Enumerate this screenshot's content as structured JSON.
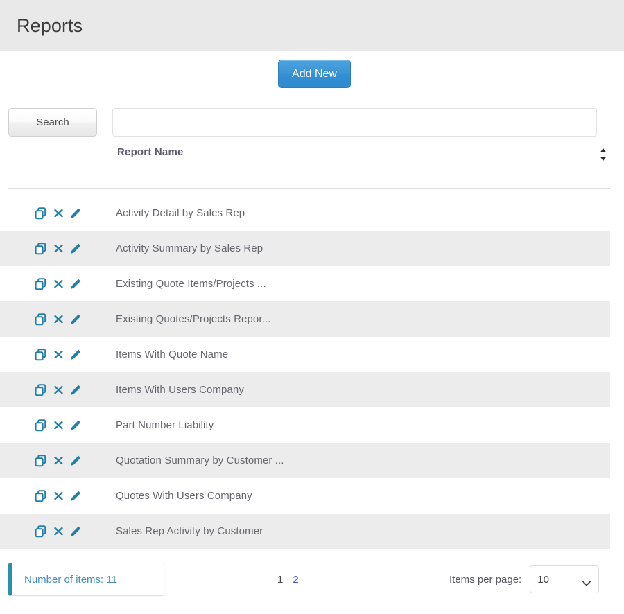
{
  "header": {
    "title": "Reports"
  },
  "toolbar": {
    "add_new_label": "Add New"
  },
  "search": {
    "button_label": "Search",
    "input_value": "",
    "placeholder": ""
  },
  "table": {
    "columns": [
      {
        "label": "Report Name",
        "sort_icon": "sort-updown-icon"
      }
    ],
    "row_actions": [
      {
        "name": "copy-icon",
        "title": "Copy"
      },
      {
        "name": "delete-icon",
        "title": "Delete"
      },
      {
        "name": "edit-pencil-icon",
        "title": "Edit"
      }
    ],
    "rows": [
      {
        "report_name": "Activity Detail by Sales Rep"
      },
      {
        "report_name": "Activity Summary by Sales Rep"
      },
      {
        "report_name": "Existing Quote Items/Projects ..."
      },
      {
        "report_name": "Existing Quotes/Projects Repor..."
      },
      {
        "report_name": "Items With Quote Name"
      },
      {
        "report_name": "Items With Users Company"
      },
      {
        "report_name": "Part Number Liability"
      },
      {
        "report_name": "Quotation Summary by Customer ..."
      },
      {
        "report_name": "Quotes With Users Company"
      },
      {
        "report_name": "Sales Rep Activity by Customer"
      }
    ]
  },
  "footer": {
    "items_count_label": "Number of items: 11",
    "pages": [
      {
        "label": "1",
        "current": true
      },
      {
        "label": "2",
        "current": false
      }
    ],
    "items_per_page_label": "Items per page:",
    "items_per_page_value": "10",
    "items_per_page_options": [
      "10"
    ]
  },
  "colors": {
    "header_bg": "#e9e9e9",
    "accent_blue": "#3b93d6",
    "icon_teal": "#2180a8",
    "row_alt_bg": "#ececec",
    "count_accent": "#2a8fae",
    "page_link": "#3b5bdb"
  }
}
